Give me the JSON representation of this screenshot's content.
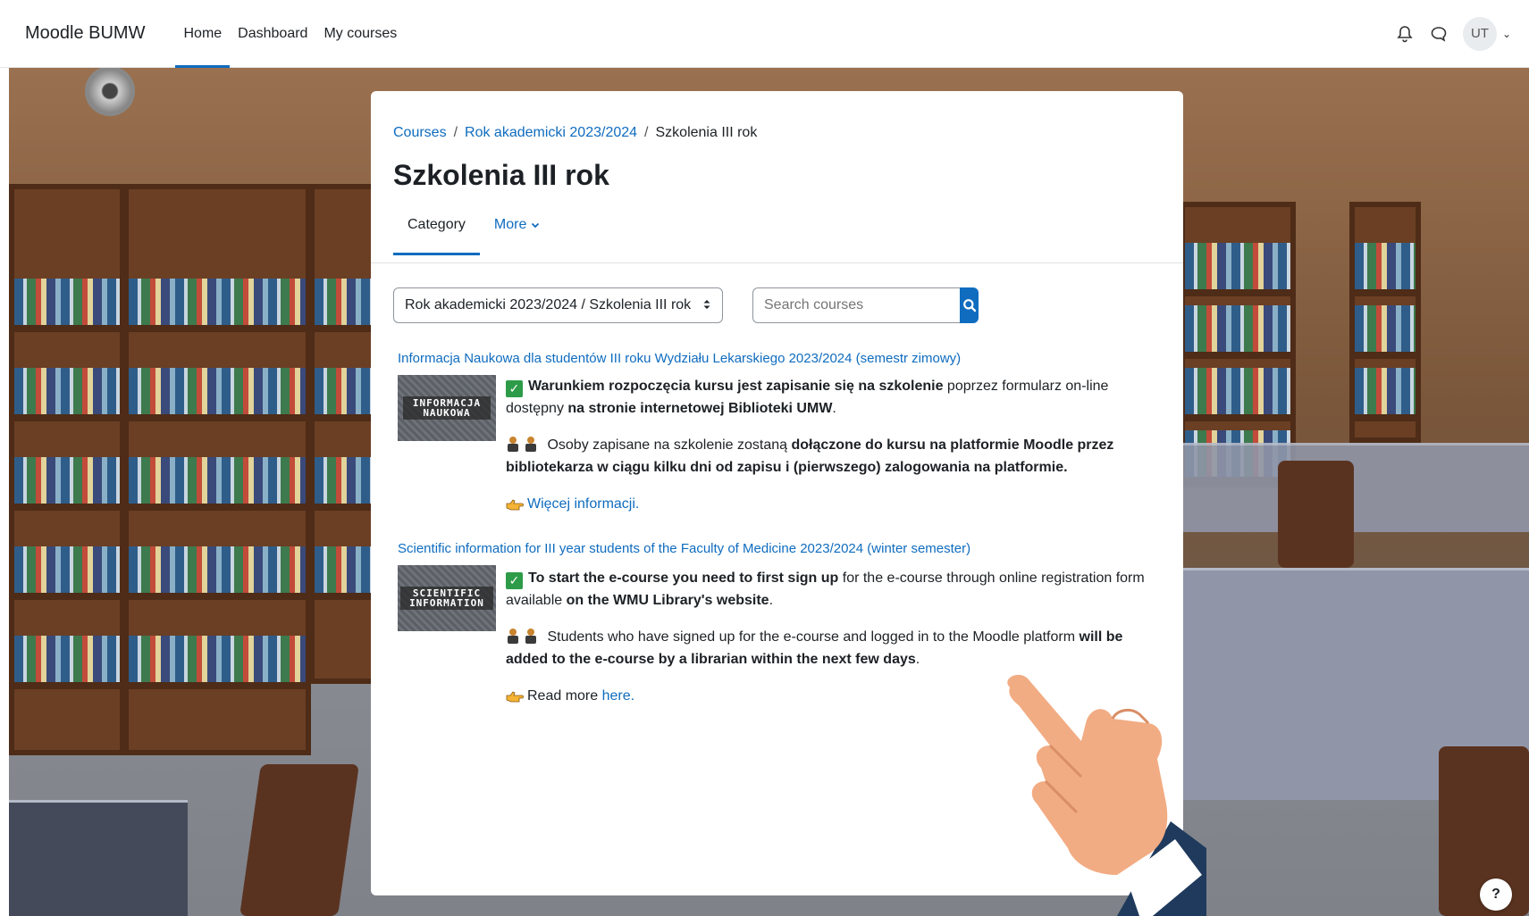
{
  "navbar": {
    "brand": "Moodle BUMW",
    "links": [
      "Home",
      "Dashboard",
      "My courses"
    ],
    "avatar_initials": "UT"
  },
  "breadcrumb": {
    "items": [
      "Courses",
      "Rok akademicki 2023/2024",
      "Szkolenia III rok"
    ]
  },
  "page_title": "Szkolenia III rok",
  "tabs": {
    "category": "Category",
    "more": "More"
  },
  "category_select": {
    "value": "Rok akademicki 2023/2024 / Szkolenia III rok"
  },
  "search": {
    "placeholder": "Search courses"
  },
  "courses": [
    {
      "title": "Informacja Naukowa dla studentów III roku Wydziału Lekarskiego 2023/2024 (semestr zimowy)",
      "image_text": "INFORMACJA NAUKOWA",
      "p1_bold": "Warunkiem rozpoczęcia kursu jest zapisanie się na szkolenie",
      "p1_rest": " poprzez formularz on-line dostępny ",
      "p1_bold2": "na stronie internetowej Biblioteki UMW",
      "p1_end": ".",
      "p2_text": " Osoby zapisane na szkolenie zostaną ",
      "p2_bold": "dołączone do kursu na platformie Moodle przez bibliotekarza w ciągu kilku dni od zapisu i (pierwszego) zalogowania na platformie.",
      "p3_link": "Więcej informacji."
    },
    {
      "title": "Scientific information for III year students of the Faculty of Medicine 2023/2024 (winter semester)",
      "image_text": "SCIENTIFIC INFORMATION",
      "p1_bold": "To start the e-course you need to first sign up",
      "p1_rest": " for the e-course through online registration form available ",
      "p1_bold2": "on the WMU Library's website",
      "p1_end": ".",
      "p2_text": " Students who have signed up for the e-course and logged in to the Moodle platform ",
      "p2_bold": "will be added to the e-course by a librarian within the next few days",
      "p2_end": ".",
      "p3_text": "Read more ",
      "p3_link": "here."
    }
  ],
  "help_button": "?",
  "colors": {
    "link": "#0f6cbf",
    "success": "#2e9b48"
  }
}
